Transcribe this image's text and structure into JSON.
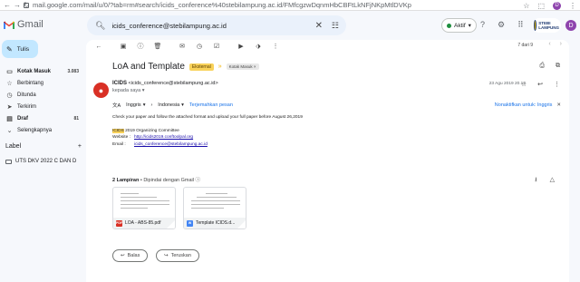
{
  "browser": {
    "url": "mail.google.com/mail/u/0/?tab=rm#search/icids_conference%40stebilampung.ac.id/FMfcgzwDqnmHbCBFtLkNFjNKpMtlDVKp",
    "avatar_letter": "D"
  },
  "header": {
    "app_name": "Gmail",
    "search_value": "icids_conference@stebilampung.ac.id",
    "status_label": "Aktif",
    "org_logo_text": "STEBI LAMPUNG",
    "avatar_letter": "D"
  },
  "sidebar": {
    "compose_label": "Tulis",
    "items": [
      {
        "label": "Kotak Masuk",
        "count": "3.083",
        "icon": "inbox-icon"
      },
      {
        "label": "Berbintang",
        "count": "",
        "icon": "star-icon"
      },
      {
        "label": "Ditunda",
        "count": "",
        "icon": "clock-icon"
      },
      {
        "label": "Terkirim",
        "count": "",
        "icon": "send-icon"
      },
      {
        "label": "Draf",
        "count": "81",
        "icon": "draft-icon"
      },
      {
        "label": "Selengkapnya",
        "count": "",
        "icon": "chevron-down-icon"
      }
    ],
    "labels_heading": "Label",
    "labels": [
      {
        "label": "UTS DKV 2022 C DAN D"
      }
    ]
  },
  "toolbar": {
    "page_count": "7 dari 9"
  },
  "email": {
    "subject": "LoA and Template",
    "badge_external": "Eksternal",
    "badge_inbox": "Kotak Masuk",
    "sender_name": "ICIDS",
    "sender_email": "<icids_conference@stebilampung.ac.id>",
    "to_line": "kepada saya",
    "date": "23 Agu 2019 20.12",
    "translate": {
      "from_lang": "Inggris",
      "to_lang": "Indonesia",
      "translate_link": "Terjemahkan pesan",
      "disable_link": "Nonaktifkan untuk: Inggris"
    },
    "body": {
      "line1": "Check your paper and follow the attached format and upload your full paper before August 26,2019",
      "sig_org_hl": "ICIDS",
      "sig_org_rest": " 2019 Organizing Committee",
      "website_label": "Website :",
      "website": "http://icids2019.conftoolpal.org",
      "email_label": "Email :",
      "email": "icids_conference@stebilampung.ac.id"
    },
    "attachments_head": "2 Lampiran",
    "attachments_scanned": "Dipindai dengan Gmail",
    "attachments": [
      {
        "name": "LOA - ABS-85.pdf",
        "type": "PDF",
        "color": "#d93025"
      },
      {
        "name": "Template ICIDS.d...",
        "type": "W",
        "color": "#4285f4"
      }
    ],
    "reply_label": "Balas",
    "forward_label": "Teruskan"
  }
}
